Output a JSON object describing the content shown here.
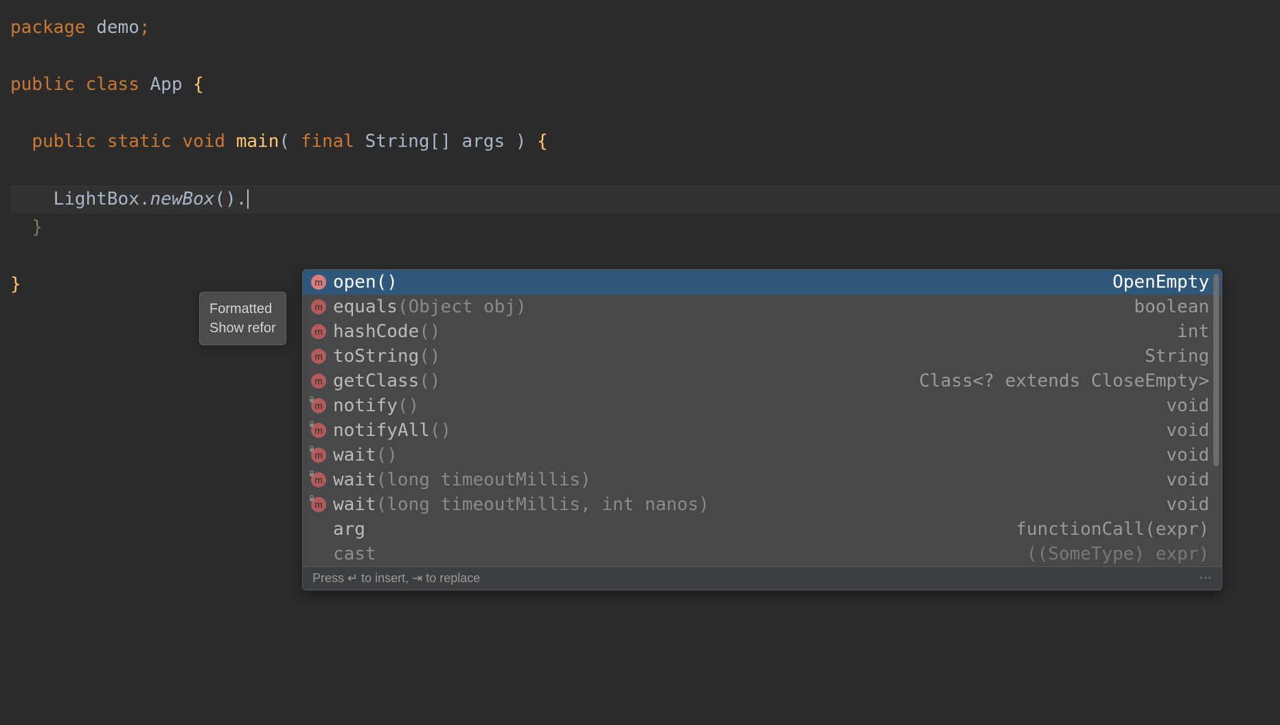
{
  "code": {
    "package_kw": "package",
    "package_name": "demo",
    "public_kw": "public",
    "class_kw": "class",
    "class_name": "App",
    "static_kw": "static",
    "void_kw": "void",
    "main_method": "main",
    "final_kw": "final",
    "string_type": "String",
    "args_name": "args",
    "lightbox_var": "LightBox",
    "newbox_method": "newBox"
  },
  "tooltip": {
    "line1": "Formatted",
    "line2": "Show refor"
  },
  "completion": {
    "items": [
      {
        "icon": "m",
        "name": "open",
        "params": "()",
        "ret": "OpenEmpty",
        "selected": true,
        "locked": false
      },
      {
        "icon": "m",
        "name": "equals",
        "params": "(Object obj)",
        "ret": "boolean",
        "selected": false,
        "locked": false
      },
      {
        "icon": "m",
        "name": "hashCode",
        "params": "()",
        "ret": "int",
        "selected": false,
        "locked": false
      },
      {
        "icon": "m",
        "name": "toString",
        "params": "()",
        "ret": "String",
        "selected": false,
        "locked": false
      },
      {
        "icon": "m",
        "name": "getClass",
        "params": "()",
        "ret": "Class<? extends CloseEmpty>",
        "selected": false,
        "locked": false
      },
      {
        "icon": "m",
        "name": "notify",
        "params": "()",
        "ret": "void",
        "selected": false,
        "locked": true
      },
      {
        "icon": "m",
        "name": "notifyAll",
        "params": "()",
        "ret": "void",
        "selected": false,
        "locked": true
      },
      {
        "icon": "m",
        "name": "wait",
        "params": "()",
        "ret": "void",
        "selected": false,
        "locked": true
      },
      {
        "icon": "m",
        "name": "wait",
        "params": "(long timeoutMillis)",
        "ret": "void",
        "selected": false,
        "locked": true
      },
      {
        "icon": "m",
        "name": "wait",
        "params": "(long timeoutMillis, int nanos)",
        "ret": "void",
        "selected": false,
        "locked": true
      },
      {
        "icon": "",
        "name": "arg",
        "params": "",
        "ret": "functionCall(expr)",
        "selected": false,
        "locked": false
      },
      {
        "icon": "",
        "name": "cast",
        "params": "",
        "ret": "((SomeType) expr)",
        "selected": false,
        "locked": false,
        "faded": true
      }
    ],
    "footer_hint": "Press ↵ to insert, ⇥ to replace"
  }
}
